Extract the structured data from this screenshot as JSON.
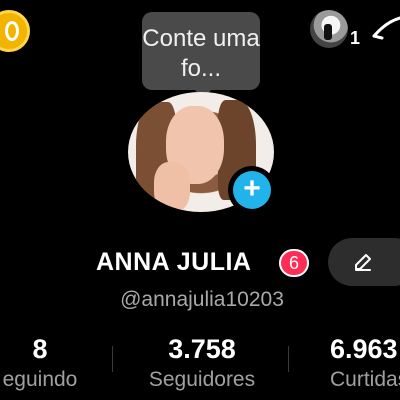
{
  "tooltip": {
    "text": "Conte uma fo..."
  },
  "notifications": {
    "count": "1"
  },
  "profile": {
    "name": "ANNA JULIA",
    "badge_count": "6",
    "handle": "@annajulia10203"
  },
  "stats": [
    {
      "value": "8",
      "label": "eguindo"
    },
    {
      "value": "3.758",
      "label": "Seguidores"
    },
    {
      "value": "6.963",
      "label": "Curtidas"
    }
  ],
  "colors": {
    "accent_blue": "#21b3ea",
    "badge_red": "#ff2d55",
    "coin_gold": "#f3b400"
  },
  "icons": {
    "coin": "coin-icon",
    "add": "plus-icon",
    "edit": "pencil-icon",
    "menu": "menu-icon"
  }
}
